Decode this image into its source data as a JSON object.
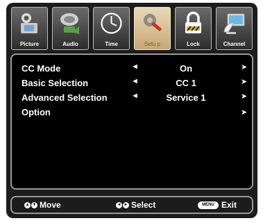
{
  "tabs": [
    {
      "label": "Picture",
      "icon": "camera-icon"
    },
    {
      "label": "Audio",
      "icon": "speaker-icon"
    },
    {
      "label": "Time",
      "icon": "clock-icon"
    },
    {
      "label": "Setu p",
      "icon": "gear-wrench-icon",
      "active": true
    },
    {
      "label": "Lock",
      "icon": "lock-icon"
    },
    {
      "label": "Channel",
      "icon": "satellite-dish-icon"
    }
  ],
  "menu": {
    "rows": [
      {
        "label": "CC Mode",
        "value": "On",
        "left_arrow": "◄",
        "right_arrow": "➤"
      },
      {
        "label": "Basic  Selection",
        "value": "CC 1",
        "left_arrow": "◄",
        "right_arrow": "➤"
      },
      {
        "label": "Advanced Selection",
        "value": "Service 1",
        "left_arrow": "◄",
        "right_arrow": "➤"
      },
      {
        "label": "Option",
        "value": "",
        "left_arrow": "",
        "right_arrow": "➤"
      }
    ]
  },
  "footer": {
    "move_label": "Move",
    "select_label": "Select",
    "exit_label": "Exit",
    "menu_key": "MENU"
  },
  "colors": {
    "background": "#1c1c1c",
    "active_tab": "#d8bf8c",
    "border": "#9a9a9a",
    "text": "#ffffff"
  }
}
